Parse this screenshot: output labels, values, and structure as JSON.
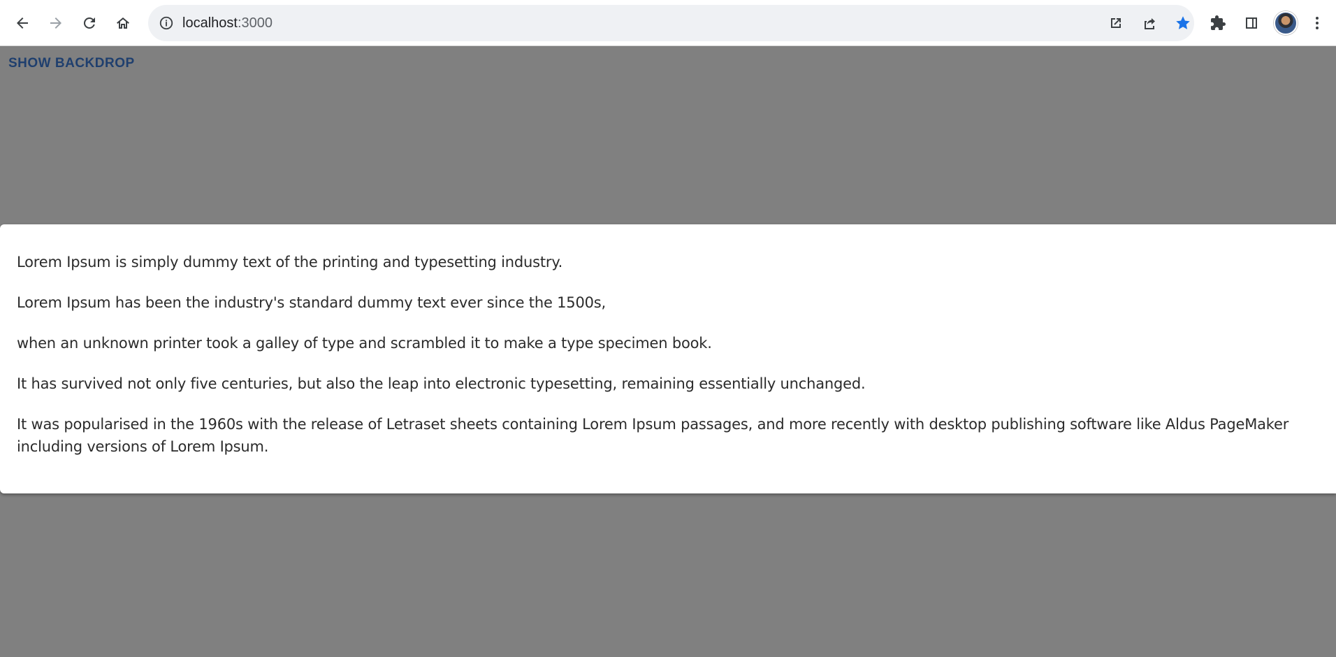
{
  "browser": {
    "url_host": "localhost",
    "url_port": ":3000",
    "icons": {
      "back": "back-arrow-icon",
      "forward": "forward-arrow-icon",
      "reload": "reload-icon",
      "home": "home-icon",
      "info": "info-icon",
      "open_external": "open-external-icon",
      "share": "share-icon",
      "bookmark": "star-icon",
      "extensions": "puzzle-icon",
      "side_panel": "side-panel-icon",
      "menu": "kebab-menu-icon"
    },
    "colors": {
      "bookmark_star": "#1a73e8"
    }
  },
  "page": {
    "show_backdrop_label": "SHOW BACKDROP",
    "backdrop_color": "#808080",
    "paragraphs": [
      "Lorem Ipsum is simply dummy text of the printing and typesetting industry.",
      "Lorem Ipsum has been the industry's standard dummy text ever since the 1500s,",
      "when an unknown printer took a galley of type and scrambled it to make a type specimen book.",
      "It has survived not only five centuries, but also the leap into electronic typesetting, remaining essentially unchanged.",
      "It was popularised in the 1960s with the release of Letraset sheets containing Lorem Ipsum passages, and more recently with desktop publishing software like Aldus PageMaker including versions of Lorem Ipsum."
    ]
  }
}
